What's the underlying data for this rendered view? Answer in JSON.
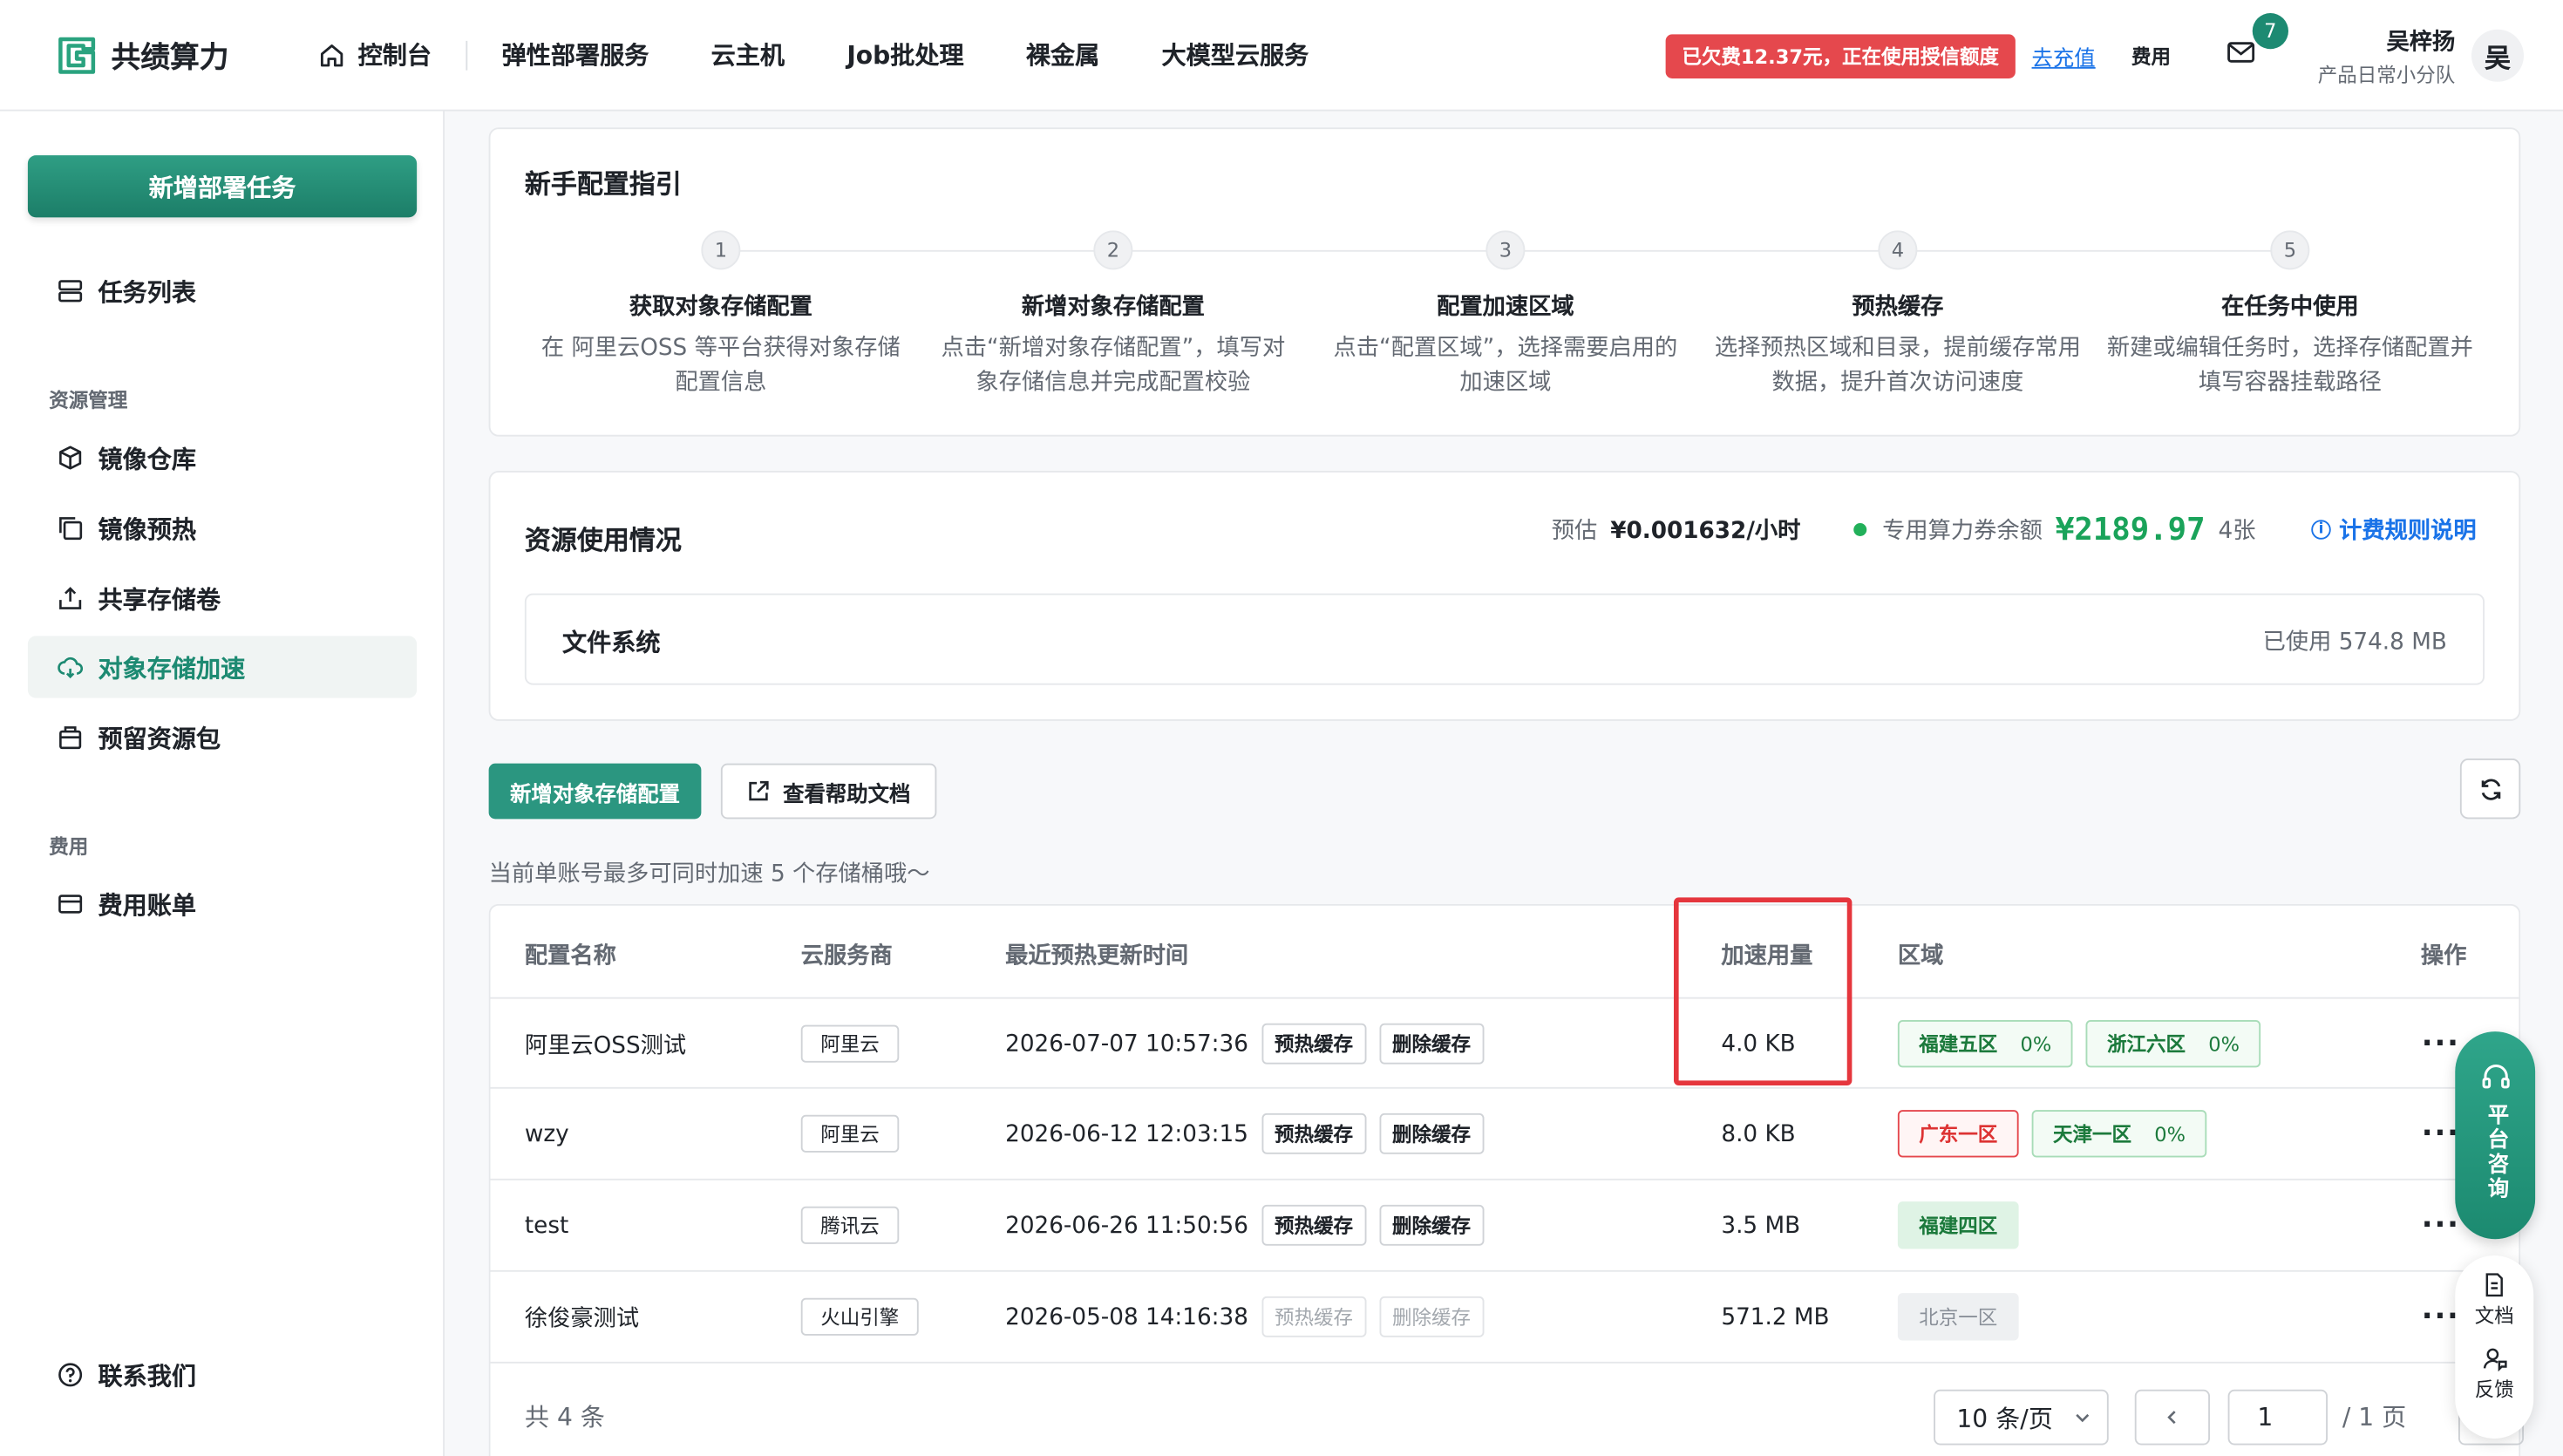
{
  "brand": {
    "name": "共绩算力",
    "accent": "#1d8a72"
  },
  "nav": {
    "console": "控制台",
    "items": [
      "弹性部署服务",
      "云主机",
      "Job批处理",
      "裸金属",
      "大模型云服务"
    ]
  },
  "header": {
    "debt_notice": "已欠费12.37元，正在使用授信额度",
    "recharge": "去充值",
    "fee": "费用",
    "mail_count": "7",
    "user_name": "吴梓扬",
    "user_team": "产品日常小分队",
    "avatar_text": "吴"
  },
  "sidebar": {
    "new_task": "新增部署任务",
    "task_list": "任务列表",
    "group_resource": "资源管理",
    "items": [
      "镜像仓库",
      "镜像预热",
      "共享存储卷",
      "对象存储加速",
      "预留资源包"
    ],
    "group_fee": "费用",
    "bill": "费用账单",
    "contact": "联系我们"
  },
  "guide": {
    "title": "新手配置指引",
    "steps": [
      {
        "num": "1",
        "title": "获取对象存储配置",
        "desc": "在 阿里云OSS 等平台获得对象存储配置信息"
      },
      {
        "num": "2",
        "title": "新增对象存储配置",
        "desc": "点击“新增对象存储配置”，填写对象存储信息并完成配置校验"
      },
      {
        "num": "3",
        "title": "配置加速区域",
        "desc": "点击“配置区域”，选择需要启用的加速区域"
      },
      {
        "num": "4",
        "title": "预热缓存",
        "desc": "选择预热区域和目录，提前缓存常用数据，提升首次访问速度"
      },
      {
        "num": "5",
        "title": "在任务中使用",
        "desc": "新建或编辑任务时，选择存储配置并填写容器挂载路径"
      }
    ]
  },
  "usage": {
    "title": "资源使用情况",
    "estimate_label": "预估",
    "estimate_value": "¥0.001632/小时",
    "coupon_label": "专用算力券余额",
    "coupon_amount": "¥2189.97",
    "coupon_count": "4张",
    "rule_link": "计费规则说明",
    "fs_label": "文件系统",
    "fs_used": "已使用 574.8 MB"
  },
  "actions": {
    "add_config": "新增对象存储配置",
    "help_doc": "查看帮助文档",
    "hint": "当前单账号最多可同时加速 5 个存储桶哦～"
  },
  "table": {
    "headers": [
      "配置名称",
      "云服务商",
      "最近预热更新时间",
      "加速用量",
      "区域",
      "操作"
    ],
    "warm_btn": "预热缓存",
    "delete_btn": "删除缓存",
    "rows": [
      {
        "name": "阿里云OSS测试",
        "provider": "阿里云",
        "time": "2026-07-07 10:57:36",
        "usage": "4.0 KB",
        "regions": [
          {
            "name": "福建五区",
            "pct": "0%",
            "style": "green"
          },
          {
            "name": "浙江六区",
            "pct": "0%",
            "style": "green"
          }
        ]
      },
      {
        "name": "wzy",
        "provider": "阿里云",
        "time": "2026-06-12 12:03:15",
        "usage": "8.0 KB",
        "regions": [
          {
            "name": "广东一区",
            "pct": "",
            "style": "red"
          },
          {
            "name": "天津一区",
            "pct": "0%",
            "style": "green"
          }
        ]
      },
      {
        "name": "test",
        "provider": "腾讯云",
        "time": "2026-06-26 11:50:56",
        "usage": "3.5 MB",
        "regions": [
          {
            "name": "福建四区",
            "pct": "",
            "style": "green-fill"
          }
        ]
      },
      {
        "name": "徐俊豪测试",
        "provider": "火山引擎",
        "time": "2026-05-08 14:16:38",
        "usage": "571.2 MB",
        "regions": [
          {
            "name": "北京一区",
            "pct": "",
            "style": "gray"
          }
        ]
      }
    ],
    "more": "···",
    "total": "共 4 条",
    "page_size": "10 条/页",
    "page": "1",
    "page_total": "/ 1 页"
  },
  "floating": {
    "consult": "平台咨询",
    "docs": "文档",
    "feedback": "反馈"
  }
}
